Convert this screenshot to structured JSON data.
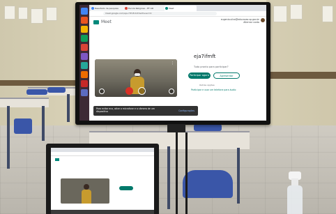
{
  "browser": {
    "tabs": [
      {
        "label": "Resultado de pesquisa",
        "color": "#4285f4"
      },
      {
        "label": "Escola Religiosa - EF AIII",
        "color": "#db4437"
      },
      {
        "label": "Meet",
        "color": "#00897b"
      }
    ],
    "address": "meet.google.com/eja-7ifmft-txt?authuser=0"
  },
  "meet": {
    "app_name": "Meet",
    "account_email": "eugenia.silva@educacao.sp.gov.br",
    "account_link": "Alternar conta",
    "meeting_code": "eja7ifmft",
    "ready_text": "Tudo pronto para participar?",
    "join_label": "Participar agora",
    "present_label": "Apresentar",
    "other_options": "Outras opções",
    "phone_audio": "Participar e usar um telefone para áudio",
    "snackbar_text": "Para evitar eco, ative o microfone e a câmera de um dispositivo",
    "snackbar_action": "Configurações"
  },
  "colors": {
    "meet_green": "#00796b",
    "sweater": "#c79b2e",
    "chair_blue": "#3a56a8"
  }
}
